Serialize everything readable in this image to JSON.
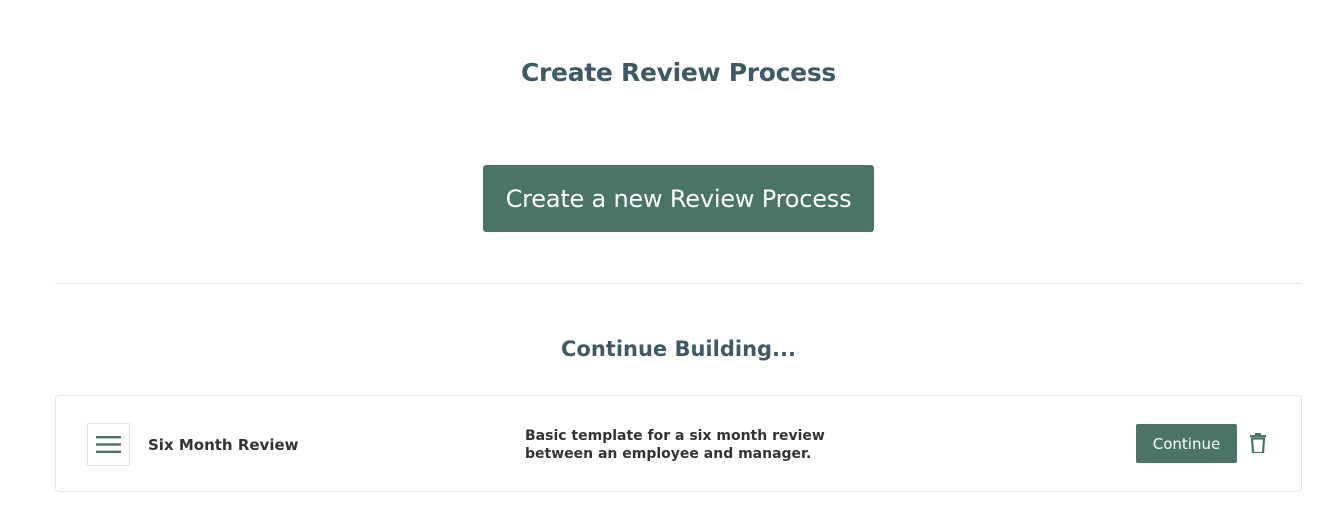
{
  "header": {
    "title": "Create Review Process"
  },
  "create_button": {
    "label": "Create a new Review Process"
  },
  "continue_section": {
    "title": "Continue Building..."
  },
  "drafts": [
    {
      "name": "Six Month Review",
      "description": "Basic template for a six month review between an employee and manager.",
      "continue_label": "Continue",
      "handle_icon": "hamburger-menu-icon",
      "delete_icon": "trash-icon"
    }
  ],
  "colors": {
    "heading": "#3f5a66",
    "primary_button": "#4a7468",
    "text": "#333333",
    "divider": "#e3e6e6"
  }
}
